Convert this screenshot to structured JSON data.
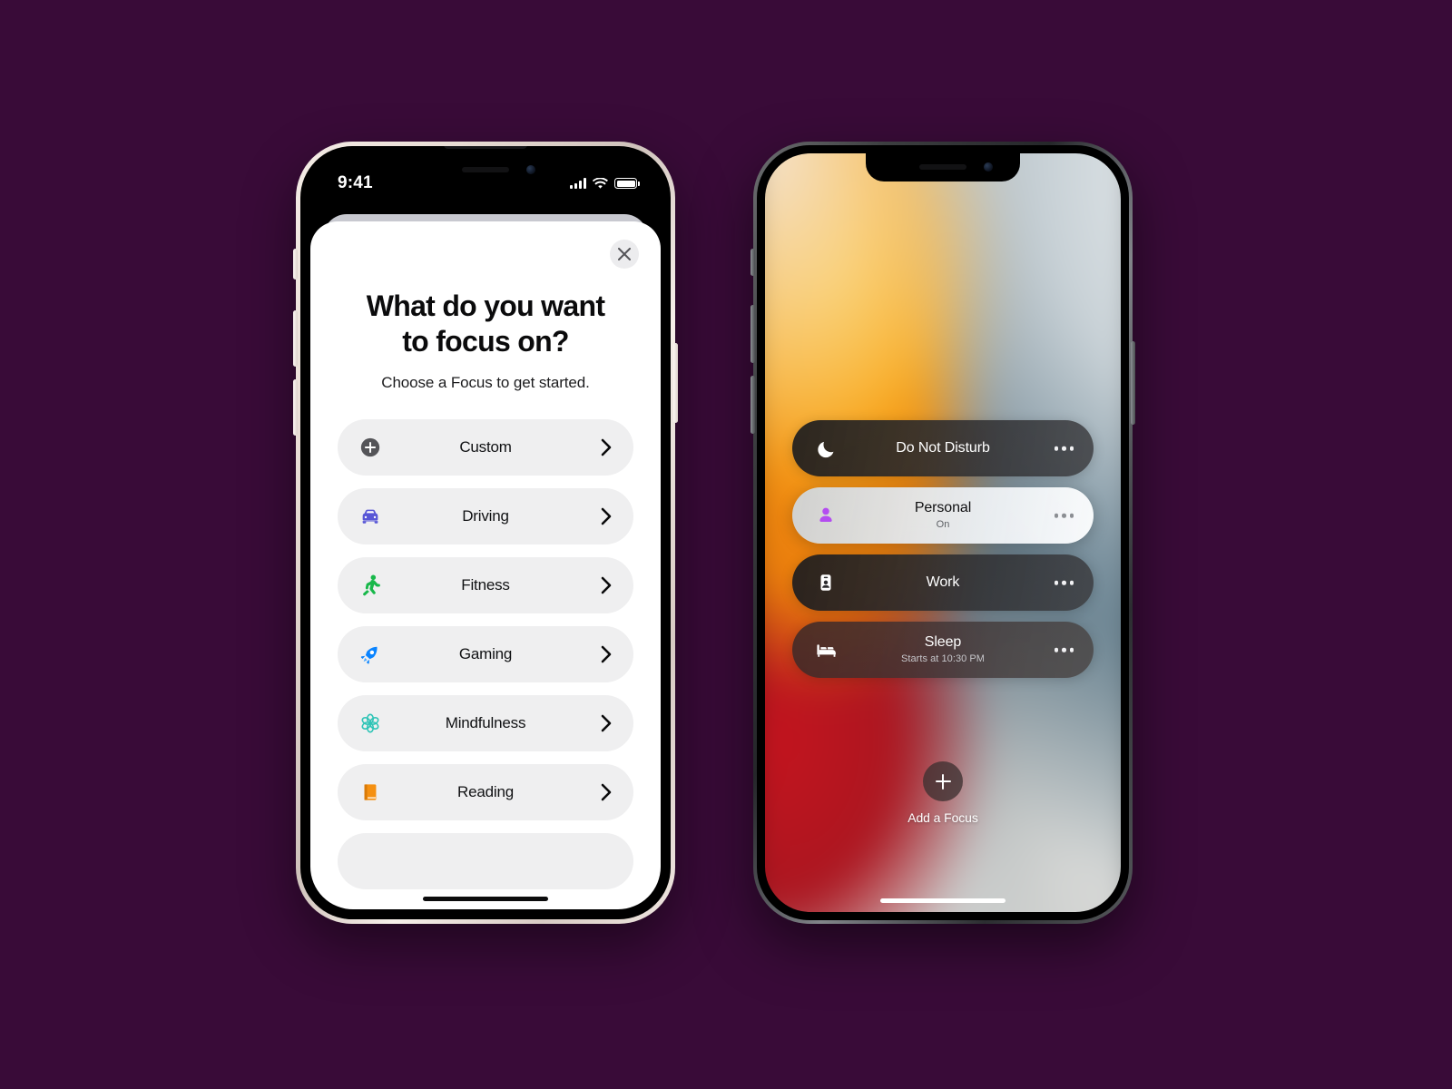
{
  "background_color": "#390b38",
  "left_phone": {
    "frame": "silver",
    "status_bar": {
      "time": "9:41",
      "icons": [
        "cellular-signal-icon",
        "wifi-icon",
        "battery-icon"
      ]
    },
    "sheet": {
      "close_label": "Close",
      "title_line1": "What do you want",
      "title_line2": "to focus on?",
      "subtitle": "Choose a Focus to get started.",
      "focus_options": [
        {
          "label": "Custom",
          "icon": "plus-circle-icon",
          "color": "#545458"
        },
        {
          "label": "Driving",
          "icon": "car-icon",
          "color": "#5856d6"
        },
        {
          "label": "Fitness",
          "icon": "running-person-icon",
          "color": "#18b84a"
        },
        {
          "label": "Gaming",
          "icon": "rocket-icon",
          "color": "#0a84ff"
        },
        {
          "label": "Mindfulness",
          "icon": "flower-icon",
          "color": "#2ec4b6"
        },
        {
          "label": "Reading",
          "icon": "book-icon",
          "color": "#f59011"
        }
      ],
      "chevron_icon": "chevron-right-icon"
    }
  },
  "right_phone": {
    "frame": "graphite",
    "wallpaper": "ios15-abstract-blur",
    "focus_modes": [
      {
        "name": "Do Not Disturb",
        "status": "",
        "icon": "moon-icon",
        "active": false,
        "style": "dark"
      },
      {
        "name": "Personal",
        "status": "On",
        "icon": "person-icon",
        "active": true,
        "style": "light",
        "icon_color": "#b44cf0"
      },
      {
        "name": "Work",
        "status": "",
        "icon": "id-badge-icon",
        "active": false,
        "style": "dark"
      },
      {
        "name": "Sleep",
        "status": "Starts at 10:30 PM",
        "icon": "bed-icon",
        "active": false,
        "style": "dark-warm"
      }
    ],
    "more_icon": "ellipsis-icon",
    "add_focus": {
      "label": "Add a Focus",
      "icon": "plus-icon"
    }
  }
}
